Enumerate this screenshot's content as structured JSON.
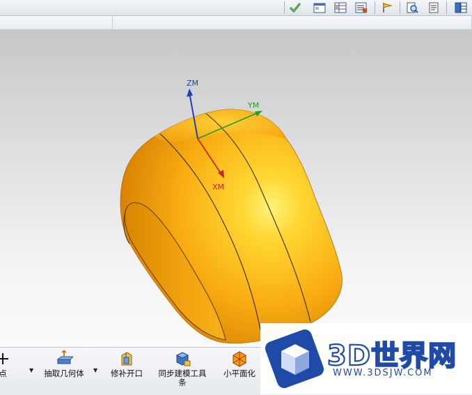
{
  "toolbar": {
    "icons": [
      "check-icon",
      "window-icon",
      "table-icon",
      "list-icon",
      "flag-icon",
      "document-magnify-icon",
      "page-icon",
      "grid-icon"
    ]
  },
  "viewport": {
    "axes": {
      "z": "ZM",
      "y": "YM",
      "x": "XM"
    },
    "colors": {
      "body": "#f5a30f",
      "z_axis": "#1f3fb8",
      "y_axis": "#2c9a2c",
      "x_axis": "#c8262a"
    }
  },
  "ribbon": {
    "partial_label": "点",
    "items": [
      {
        "label": "抽取几何体",
        "icon": "extract-geometry-icon"
      },
      {
        "label": "修补开口",
        "icon": "patch-opening-icon"
      },
      {
        "label": "同步建模工具条",
        "icon": "sync-modeling-icon"
      },
      {
        "label": "小平面化",
        "icon": "facet-icon"
      }
    ]
  },
  "watermark": {
    "title": "3D世界网",
    "url": "WWW.3DSJW.COM"
  }
}
